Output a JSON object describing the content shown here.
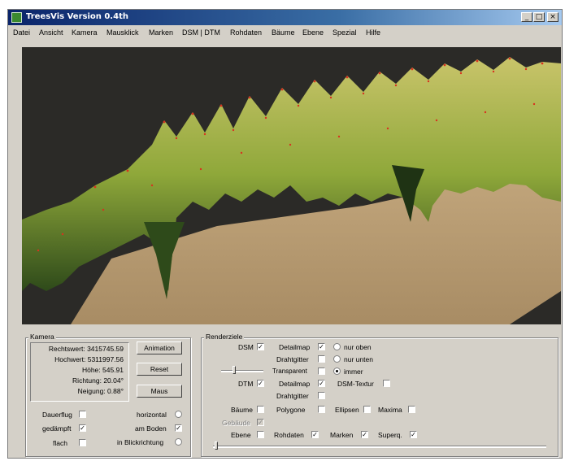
{
  "window": {
    "title": "TreesVis Version 0.4th",
    "controls": [
      "_",
      "□",
      "×"
    ]
  },
  "menu": [
    "Datei",
    "Ansicht",
    "Kamera",
    "Mausklick",
    "Marken",
    "DSM | DTM",
    "Rohdaten",
    "Bäume",
    "Ebene",
    "Spezial",
    "Hilfe"
  ],
  "kamera": {
    "label": "Kamera",
    "info": {
      "rechtswert": "Rechtswert: 3415745.59",
      "hochwert": "Hochwert: 5311997.56",
      "hoehe": "Höhe: 545.91",
      "richtung": "Richtung: 20.04°",
      "neigung": "Neigung: 0.88°"
    },
    "buttons": {
      "animation": "Animation",
      "reset": "Reset",
      "maus": "Maus"
    },
    "options": {
      "dauerflug": "Dauerflug",
      "gedaempft": "gedämpft",
      "flach": "flach",
      "horizontal": "horizontal",
      "am_boden": "am Boden",
      "in_blickrichtung": "in Blickrichtung"
    },
    "states": {
      "dauerflug": false,
      "gedaempft": true,
      "flach": false,
      "horizontal": false,
      "am_boden": true,
      "in_blickrichtung": false
    }
  },
  "renderziele": {
    "label": "Renderziele",
    "dsm": "DSM",
    "detailmap": "Detailmap",
    "drahtgitter": "Drahtgitter",
    "transparent": "Transparent",
    "nur_oben": "nur oben",
    "nur_unten": "nur unten",
    "immer": "immer",
    "dtm": "DTM",
    "dsm_textur": "DSM-Textur",
    "baeume": "Bäume",
    "polygone": "Polygone",
    "ellipsen": "Ellipsen",
    "maxima": "Maxima",
    "gebaeude": "Gebäude",
    "ebene": "Ebene",
    "rohdaten": "Rohdaten",
    "marken": "Marken",
    "superq": "Superq.",
    "states": {
      "dsm": true,
      "dsm_detailmap": true,
      "dsm_drahtgitter": false,
      "transparent": false,
      "radio": "immer",
      "dtm": true,
      "dtm_detailmap": true,
      "dtm_drahtgitter": false,
      "dsm_textur": false,
      "baeume": false,
      "polygone": false,
      "ellipsen": false,
      "maxima": false,
      "gebaeude": true,
      "ebene": false,
      "rohdaten": true,
      "marken": true,
      "superq": true
    }
  },
  "colors": {
    "title_bar": "#0a246a",
    "face": "#d4d0c8",
    "terrain_green": "#8fa83a",
    "ground": "#bda37a",
    "marker": "#d8321f"
  }
}
